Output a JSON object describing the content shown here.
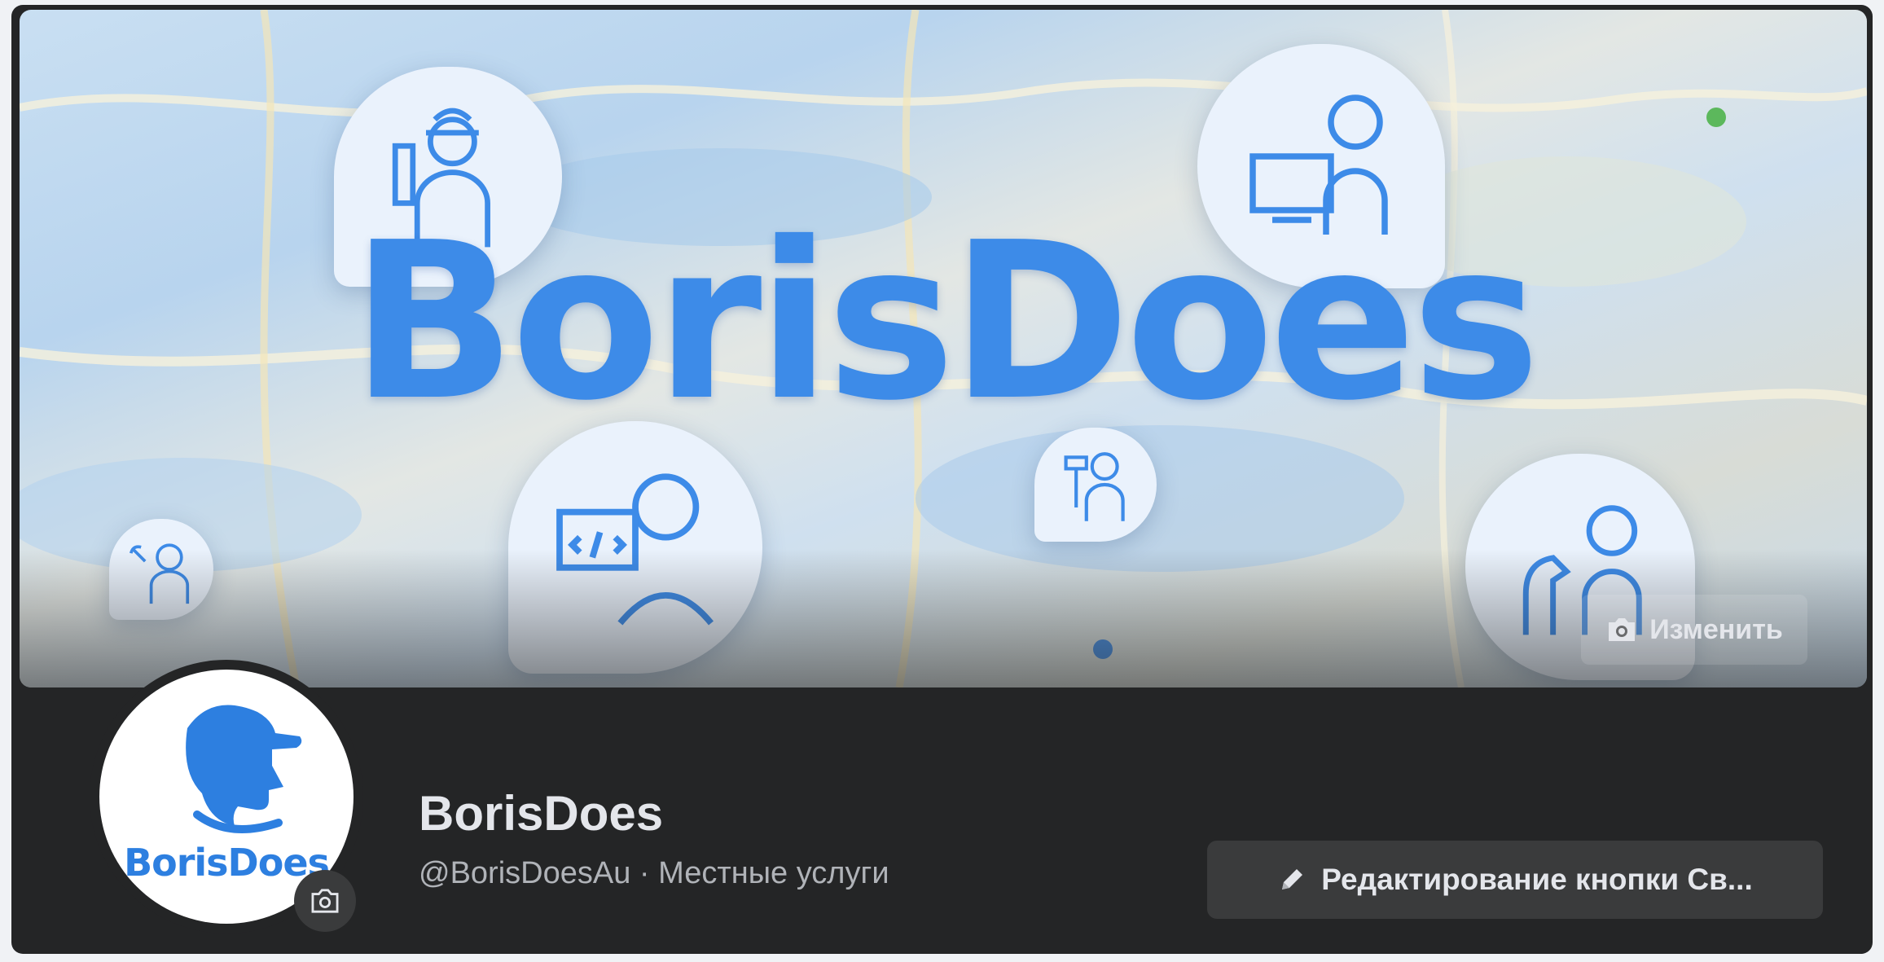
{
  "cover": {
    "brand_text": "BorisDoes",
    "edit_button_label": "Изменить",
    "edit_icon": "camera-icon",
    "bubbles": [
      "plumber-icon",
      "receptionist-icon",
      "programmer-icon",
      "painter-icon",
      "vet-icon",
      "mechanic-icon"
    ]
  },
  "profile": {
    "avatar_label": "BorisDoes",
    "avatar_icon": "worker-head-icon",
    "avatar_camera_icon": "camera-icon",
    "page_name": "BorisDoes",
    "subtitle": "@BorisDoesAu · Местные услуги"
  },
  "actions": {
    "cta_label": "Редактирование кнопки Св...",
    "cta_icon": "pencil-icon"
  },
  "colors": {
    "brand_blue": "#3d8be8",
    "panel_bg": "#242526",
    "button_bg": "#3a3b3c",
    "text_primary": "#e4e6eb",
    "text_secondary": "#b0b3b8"
  }
}
